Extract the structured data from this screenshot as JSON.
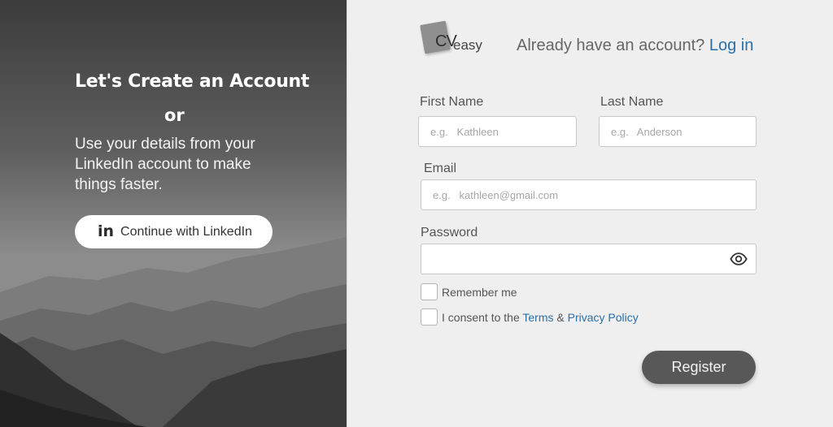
{
  "left": {
    "title": "Let's Create an Account",
    "or": "or",
    "description": "Use your details from your LinkedIn account to make things faster.",
    "linkedin_button": {
      "icon": "in",
      "label": "Continue with LinkedIn"
    }
  },
  "header": {
    "logo_cv": "CV",
    "logo_easy": "easy",
    "login_prompt": "Already have an account?",
    "login_link": "Log in"
  },
  "form": {
    "first_name": {
      "label": "First Name",
      "placeholder": "e.g.   Kathleen",
      "value": ""
    },
    "last_name": {
      "label": "Last Name",
      "placeholder": "e.g.   Anderson",
      "value": ""
    },
    "email": {
      "label": "Email",
      "placeholder": "e.g.   kathleen@gmail.com",
      "value": ""
    },
    "password": {
      "label": "Password",
      "value": "",
      "toggle_icon": "eye-icon"
    },
    "remember_me": {
      "label": "Remember me",
      "checked": false
    },
    "consent": {
      "prefix": "I consent to the ",
      "terms": "Terms",
      "and": " & ",
      "privacy": "Privacy Policy",
      "checked": false
    },
    "register_label": "Register"
  },
  "colors": {
    "accent_link": "#2a6fa8",
    "register_bg": "#585858",
    "panel_bg": "#efefef"
  }
}
